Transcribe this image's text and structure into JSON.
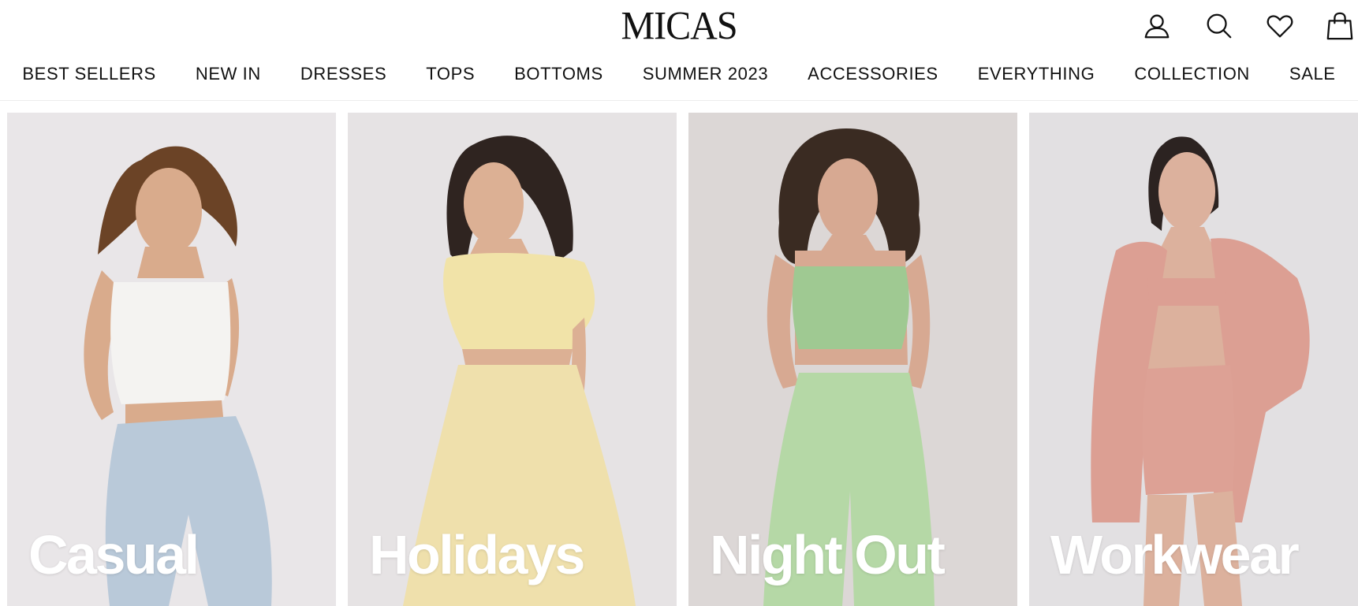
{
  "brand": {
    "logo_text": "MICAS"
  },
  "header_icons": [
    {
      "name": "account-icon"
    },
    {
      "name": "search-icon"
    },
    {
      "name": "wishlist-icon"
    },
    {
      "name": "cart-icon"
    }
  ],
  "nav": {
    "items": [
      {
        "label": "BEST SELLERS"
      },
      {
        "label": "NEW IN"
      },
      {
        "label": "DRESSES"
      },
      {
        "label": "TOPS"
      },
      {
        "label": "BOTTOMS"
      },
      {
        "label": "SUMMER 2023"
      },
      {
        "label": "ACCESSORIES"
      },
      {
        "label": "EVERYTHING"
      },
      {
        "label": "COLLECTION"
      },
      {
        "label": "SALE"
      }
    ]
  },
  "categories": [
    {
      "label": "Casual",
      "bg": "#e9e6e8",
      "outfit_top": "#f4f3f1",
      "outfit_bottom": "#b9c9d9",
      "hair": "#6b4326",
      "skin": "#d9ab8c"
    },
    {
      "label": "Holidays",
      "bg": "#e6e3e4",
      "outfit_top": "#f1e3a8",
      "outfit_bottom": "#efe0ac",
      "hair": "#2f2420",
      "skin": "#dcb094"
    },
    {
      "label": "Night Out",
      "bg": "#dcd7d6",
      "outfit_top": "#9fc992",
      "outfit_bottom": "#b5d8a6",
      "hair": "#3a2b22",
      "skin": "#d7a992"
    },
    {
      "label": "Workwear",
      "bg": "#e2e0e2",
      "outfit_top": "#dc9f93",
      "outfit_bottom": "#dda195",
      "hair": "#2c2321",
      "skin": "#dcb19d"
    }
  ]
}
